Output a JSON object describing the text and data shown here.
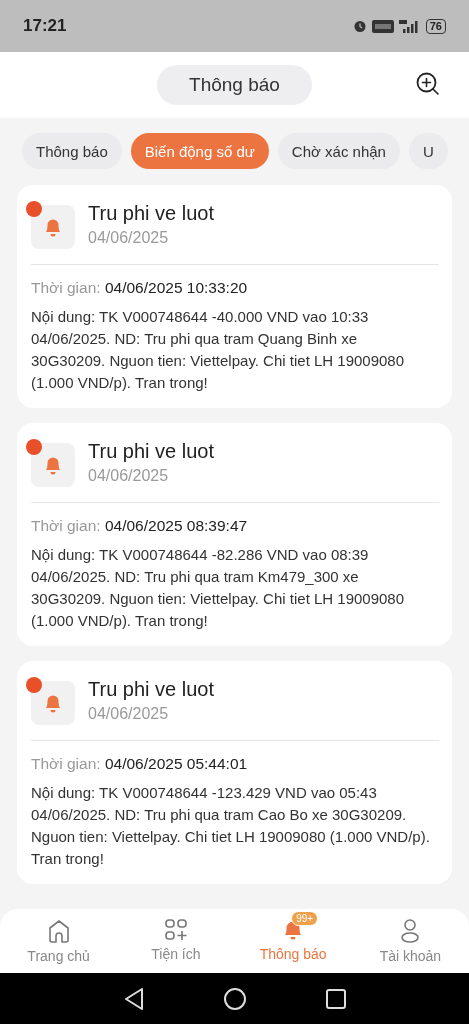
{
  "status_bar": {
    "time": "17:21",
    "battery": "76"
  },
  "header": {
    "title": "Thông báo"
  },
  "filters": [
    {
      "label": "Thông báo",
      "selected": false
    },
    {
      "label": "Biến động số dư",
      "selected": true
    },
    {
      "label": "Chờ xác nhận",
      "selected": false
    },
    {
      "label": "U",
      "selected": false
    }
  ],
  "notifications": [
    {
      "title": "Tru phi ve luot",
      "date": "04/06/2025",
      "unread": true,
      "time_label": "Thời gian:",
      "time": "04/06/2025 10:33:20",
      "content": "Nội dung: TK V000748644 -40.000 VND vao 10:33 04/06/2025. ND: Tru phi qua tram Quang Binh xe 30G30209. Nguon tien: Viettelpay. Chi tiet LH 19009080 (1.000 VND/p). Tran trong!"
    },
    {
      "title": "Tru phi ve luot",
      "date": "04/06/2025",
      "unread": true,
      "time_label": "Thời gian:",
      "time": "04/06/2025 08:39:47",
      "content": "Nội dung: TK V000748644 -82.286 VND vao 08:39 04/06/2025. ND: Tru phi qua tram Km479_300 xe 30G30209. Nguon tien: Viettelpay. Chi tiet LH 19009080 (1.000 VND/p). Tran trong!"
    },
    {
      "title": "Tru phi ve luot",
      "date": "04/06/2025",
      "unread": true,
      "time_label": "Thời gian:",
      "time": "04/06/2025 05:44:01",
      "content": "Nội dung: TK V000748644 -123.429 VND vao 05:43 04/06/2025. ND: Tru phi qua tram Cao Bo xe 30G30209. Nguon tien: Viettelpay. Chi tiet LH 19009080 (1.000 VND/p). Tran trong!"
    }
  ],
  "bottom_nav": [
    {
      "kind": "home",
      "label": "Trang chủ",
      "selected": false
    },
    {
      "kind": "apps",
      "label": "Tiện ích",
      "selected": false
    },
    {
      "kind": "bell",
      "label": "Thông báo",
      "selected": true,
      "badge": "99+"
    },
    {
      "kind": "user",
      "label": "Tài khoản",
      "selected": false
    }
  ]
}
